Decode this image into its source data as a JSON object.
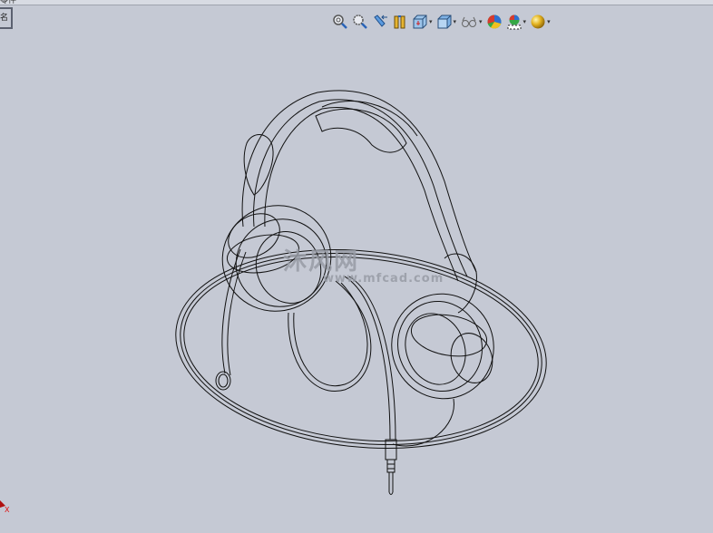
{
  "window": {
    "top_strip_text": "零件",
    "side_tab_label": "名"
  },
  "toolbar": {
    "items": [
      {
        "icon": "zoom-to-fit-icon",
        "has_dropdown": false
      },
      {
        "icon": "zoom-to-area-icon",
        "has_dropdown": false
      },
      {
        "icon": "previous-view-icon",
        "has_dropdown": false
      },
      {
        "icon": "section-view-icon",
        "has_dropdown": false
      },
      {
        "icon": "view-orientation-icon",
        "has_dropdown": true
      },
      {
        "icon": "display-style-icon",
        "has_dropdown": true
      },
      {
        "icon": "hide-show-items-icon",
        "has_dropdown": true
      },
      {
        "icon": "edit-appearance-icon",
        "has_dropdown": false
      },
      {
        "icon": "apply-scene-icon",
        "has_dropdown": true
      },
      {
        "icon": "view-settings-icon",
        "has_dropdown": true
      }
    ],
    "dropdown_glyph": "▾"
  },
  "watermark": {
    "text": "沐风网",
    "url": "www.mfcad.com"
  },
  "triad": {
    "axis_label": "X",
    "color": "#e01010"
  },
  "colors": {
    "background": "#c5c9d4",
    "wireframe": "#111111"
  }
}
